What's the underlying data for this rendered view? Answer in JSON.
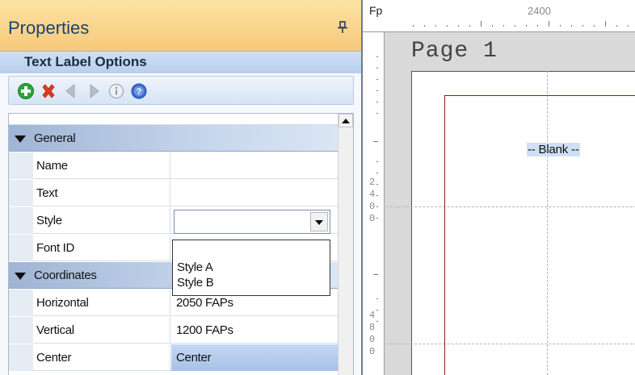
{
  "panel": {
    "title": "Properties",
    "section_title": "Text Label Options",
    "toolbar": {
      "icons": [
        "add-icon",
        "delete-icon",
        "previous-icon",
        "next-icon",
        "info-icon",
        "help-icon"
      ]
    },
    "categories": {
      "general": "General",
      "coordinates": "Coordinates"
    },
    "rows": {
      "name": {
        "label": "Name",
        "value": ""
      },
      "text": {
        "label": "Text",
        "value": ""
      },
      "style": {
        "label": "Style",
        "value": ""
      },
      "font_id": {
        "label": "Font ID",
        "value": ""
      },
      "horizontal": {
        "label": "Horizontal",
        "value": "2050 FAPs"
      },
      "vertical": {
        "label": "Vertical",
        "value": "1200 FAPs"
      },
      "center": {
        "label": "Center",
        "value": "Center"
      }
    },
    "style_options": [
      "Style A",
      "Style B"
    ]
  },
  "canvas": {
    "corner_label": "Fp",
    "ruler_top_number": "2400",
    "ruler_left_numbers": [
      "2",
      "4",
      "0",
      "0",
      "4",
      "8",
      "0",
      "0"
    ],
    "page_label": "Page 1",
    "blank_label": "-- Blank --"
  },
  "colors": {
    "header_gradient_top": "#fbe3a3",
    "header_gradient_bottom": "#f7c97a",
    "category_band": "#9fb5d5",
    "label_frame": "#8b1a1a",
    "selection": "#a7c1e6"
  }
}
